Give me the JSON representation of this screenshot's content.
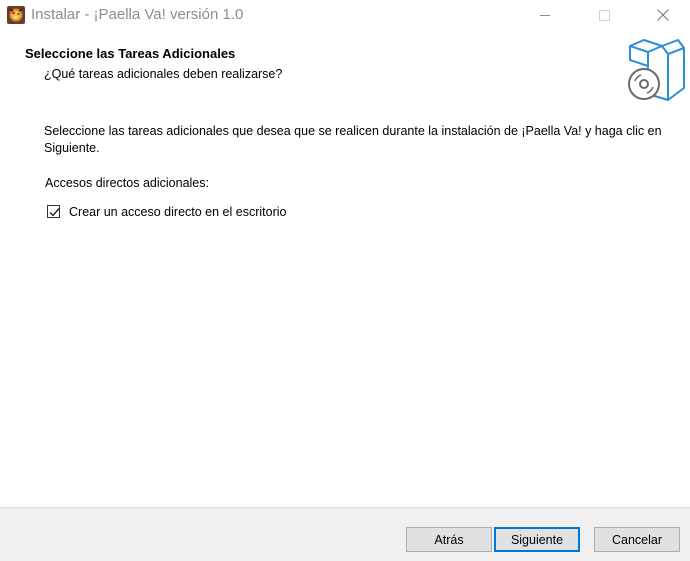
{
  "window": {
    "title": "Instalar - ¡Paella Va! versión 1.0"
  },
  "header": {
    "title": "Seleccione las Tareas Adicionales",
    "subtitle": "¿Qué tareas adicionales deben realizarse?"
  },
  "body": {
    "description": "Seleccione las tareas adicionales que desea que se realicen durante la instalación de ¡Paella Va! y haga clic en Siguiente.",
    "group_label": "Accesos directos adicionales:",
    "tasks": [
      {
        "label": "Crear un acceso directo en el escritorio",
        "checked": true
      }
    ]
  },
  "footer": {
    "back_label": "Atrás",
    "next_label": "Siguiente",
    "cancel_label": "Cancelar"
  },
  "colors": {
    "accent": "#0078d7",
    "footer_bg": "#f0f0f0",
    "icon_blue": "#2a8fd6"
  },
  "icons": {
    "app": "paella-app-icon",
    "wizard": "box-disc-icon",
    "minimize": "minimize-icon",
    "maximize": "maximize-icon",
    "close": "close-icon",
    "check": "checkmark-icon"
  }
}
